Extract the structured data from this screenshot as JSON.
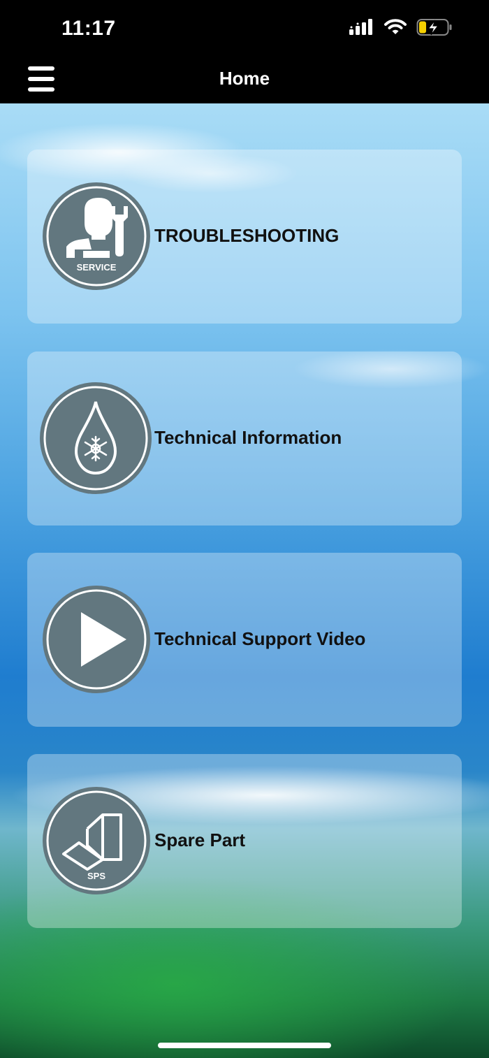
{
  "status_bar": {
    "time": "11:17",
    "icons": [
      "cellular-signal-icon",
      "wifi-icon",
      "battery-charging-icon"
    ]
  },
  "nav": {
    "title": "Home",
    "menu_icon": "hamburger-menu-icon"
  },
  "menu_items": [
    {
      "label": "TROUBLESHOOTING",
      "icon": "service-technician-icon",
      "icon_text": "SERVICE"
    },
    {
      "label": "Technical Information",
      "icon": "snowflake-drop-icon"
    },
    {
      "label": "Technical Support Video",
      "icon": "play-icon"
    },
    {
      "label": "Spare Part",
      "icon": "spare-part-icon",
      "icon_text": "SPS"
    }
  ],
  "colors": {
    "icon_background": "#62777f",
    "battery_level": "#f5d000"
  }
}
